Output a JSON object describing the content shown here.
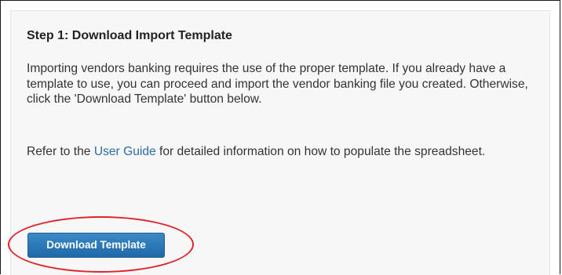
{
  "section": {
    "title": "Step 1: Download Import Template",
    "paragraph1": "Importing vendors banking requires the use of the proper template. If you already have a template to use, you can proceed and import the vendor banking file you created. Otherwise, click the 'Download Template' button below.",
    "paragraph2_prefix": "Refer to the ",
    "paragraph2_link": "User Guide",
    "paragraph2_suffix": " for detailed information on how to populate the spreadsheet."
  },
  "actions": {
    "download_label": "Download Template"
  },
  "colors": {
    "link": "#2b6aa5",
    "button": "#2a75b6",
    "highlight": "#e0222a"
  }
}
